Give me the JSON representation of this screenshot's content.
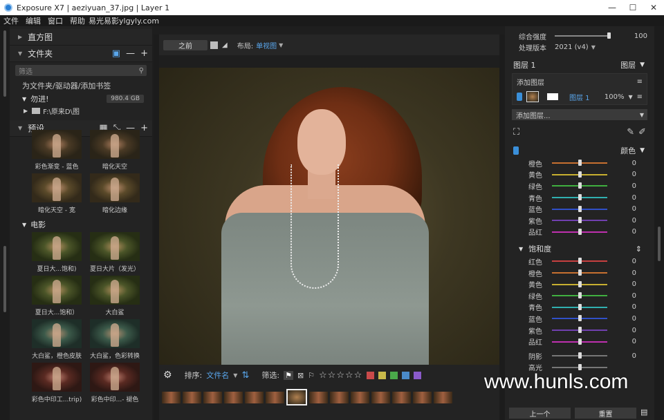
{
  "window": {
    "title": "Exposure X7 | aeziyuan_37.jpg | Layer 1",
    "minimize": "—",
    "maximize": "☐",
    "close": "✕"
  },
  "menu": {
    "items": [
      "文件",
      "编辑",
      "窗口",
      "帮助"
    ],
    "overlay": "易光易影ylgyly.com"
  },
  "left": {
    "histogram": "直方图",
    "folders": "文件夹",
    "filter_placeholder": "筛选",
    "bookmark": "为文件夹/驱动器/添加书签",
    "drive": {
      "name": "勿进!",
      "size": "980.4 GB"
    },
    "subfolder": "F:\\原来D\\图",
    "presets": "预设",
    "preset_top": [
      "彩色渐变 - 蓝色",
      "暗化天空",
      "暗化天空 - 宽",
      "暗化边缘"
    ],
    "category": "电影",
    "movie_presets": [
      "夏日大...饱和)",
      "夏日大片（发光）",
      "夏日大...饱和）",
      "大白鲨",
      "大白鲨，橙色皮肤",
      "大白鲨，色彩转换",
      "彩色中印工...trip)",
      "彩色中印...- 褪色"
    ]
  },
  "center": {
    "before": "之前",
    "layout_label": "布局:",
    "layout_value": "单视图",
    "sort_label": "排序:",
    "sort_value": "文件名",
    "filter_label": "筛选:",
    "stars": "☆☆☆☆☆",
    "swatch_colors": [
      "#c94a4a",
      "#c9b94a",
      "#4aa84a",
      "#4a8ac9",
      "#8a5ac9"
    ]
  },
  "right": {
    "intensity_label": "综合强度",
    "intensity_value": "100",
    "intensity_level": 0.9,
    "version_label": "处理版本",
    "version_value": "2021 (v4)",
    "layers_title": "图层 1",
    "layers_header": "图层",
    "add_layer": "添加图层",
    "layer_name": "图层 1",
    "layer_opacity": "100%",
    "add_layer_dropdown": "添加图层...",
    "color_header": "颜色",
    "hue_rows": [
      {
        "name": "橙色",
        "value": "0",
        "color": "#c87030"
      },
      {
        "name": "黄色",
        "value": "0",
        "color": "#c8b030"
      },
      {
        "name": "绿色",
        "value": "0",
        "color": "#40b040"
      },
      {
        "name": "青色",
        "value": "0",
        "color": "#30b0b0"
      },
      {
        "name": "蓝色",
        "value": "0",
        "color": "#3050c8"
      },
      {
        "name": "紫色",
        "value": "0",
        "color": "#7040b0"
      },
      {
        "name": "品红",
        "value": "0",
        "color": "#c030b0"
      }
    ],
    "saturation_header": "饱和度",
    "sat_rows": [
      {
        "name": "红色",
        "value": "0",
        "color": "#c84040"
      },
      {
        "name": "橙色",
        "value": "0",
        "color": "#c87030"
      },
      {
        "name": "黄色",
        "value": "0",
        "color": "#c8b030"
      },
      {
        "name": "绿色",
        "value": "0",
        "color": "#40b040"
      },
      {
        "name": "青色",
        "value": "0",
        "color": "#30b0b0"
      },
      {
        "name": "蓝色",
        "value": "0",
        "color": "#3050c8"
      },
      {
        "name": "紫色",
        "value": "0",
        "color": "#7040b0"
      },
      {
        "name": "品红",
        "value": "0",
        "color": "#c030b0"
      }
    ],
    "shadow_label": "阴影",
    "shadow_value": "0",
    "highlight_label": "高光",
    "prev_button": "上一个",
    "reset_button": "重置"
  },
  "watermark": "www.hunls.com"
}
